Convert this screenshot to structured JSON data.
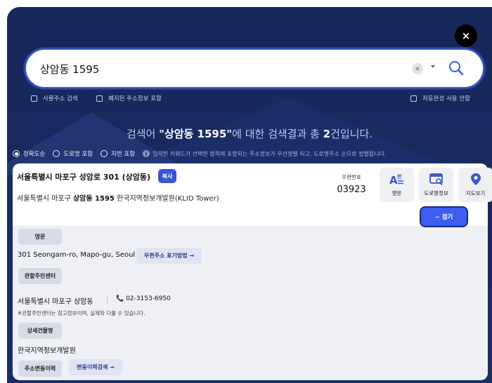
{
  "search": {
    "value": "상암동 1595",
    "clear_icon": "×",
    "close_icon": "×"
  },
  "options": {
    "private_addr": "사물주소 검색",
    "abolished_addr": "폐지된 주소정보 포함",
    "autocomplete_off": "자동완성 사용 안함"
  },
  "result": {
    "prefix": "검색어 ",
    "keyword": "\"상암동 1595\"",
    "middle": "에 대한 검색결과 총 ",
    "count": "2",
    "suffix": "건입니다."
  },
  "sort": {
    "accuracy": "정확도순",
    "road_name": "도로명 포함",
    "jibun": "지번 포함",
    "info_icon": "i",
    "note": "입력한 키워드가 선택한 항목에 포함되는 주소정보가 우선정렬 되고, 도로명주소 순으로 정렬됩니다."
  },
  "item": {
    "road_address": "서울특별시 마포구 성암로 301 (상암동)",
    "copy_label": "복사",
    "jibun_prefix": "서울특별시 마포구 ",
    "jibun_bold": "상암동 1595",
    "jibun_suffix": " 한국지역정보개발원(KLID Tower)",
    "zip_label": "우편번호",
    "zip_code": "03923",
    "english_btn": "영문",
    "road_info_btn": "도로명정보",
    "map_btn": "지도보기",
    "fold_btn": "− 접기"
  },
  "details": {
    "english_tag": "영문",
    "english_address": "301 Seongam-ro, Mapo-gu, Seoul",
    "postal_format_link": "우편주소 표기방법 →",
    "office_tag": "관할주민센터",
    "office_name": "서울특별시 마포구 상암동",
    "office_phone": "📞 02-3153-6950",
    "office_note": "※관할주민센터는 참고정보이며, 실제와 다를 수 있습니다.",
    "building_tag": "상세건물명",
    "building_name": "한국지역정보개발원",
    "history_tag": "주소변동이력",
    "history_link": "변동이력검색 →"
  },
  "colors": {
    "background": "#16275a",
    "accent": "#3a56d4",
    "fold_button": "#3d5df0"
  },
  "icons": {
    "close": "close-icon",
    "search": "search-icon",
    "english": "english-translate-icon",
    "road_info": "road-info-icon",
    "map": "map-pin-icon"
  }
}
